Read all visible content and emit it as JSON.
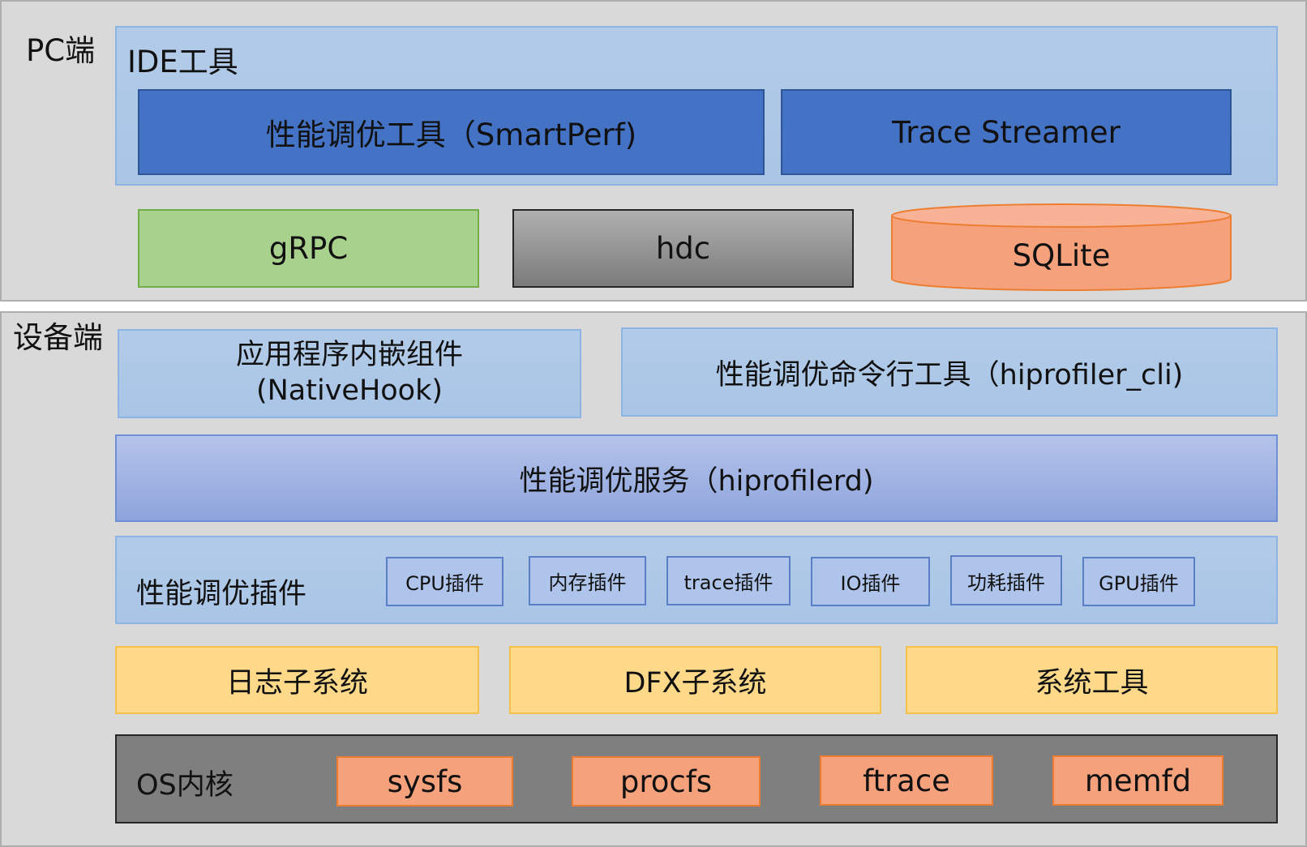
{
  "pc_section": {
    "label": "PC端",
    "ide": {
      "title": "IDE工具",
      "smartperf": "性能调优工具（SmartPerf)",
      "trace_streamer": "Trace Streamer"
    },
    "grpc": "gRPC",
    "hdc": "hdc",
    "sqlite": "SQLite"
  },
  "device_section": {
    "label": "设备端",
    "nativehook_line1": "应用程序内嵌组件",
    "nativehook_line2": "(NativeHook)",
    "cli": "性能调优命令行工具（hiprofiler_cli)",
    "service": "性能调优服务（hiprofilerd)",
    "plugins": {
      "title": "性能调优插件",
      "items": [
        "CPU插件",
        "内存插件",
        "trace插件",
        "IO插件",
        "功耗插件",
        "GPU插件"
      ]
    },
    "subsystems": [
      "日志子系统",
      "DFX子系统",
      "系统工具"
    ],
    "os": {
      "title": "OS内核",
      "items": [
        "sysfs",
        "procfs",
        "ftrace",
        "memfd"
      ]
    }
  },
  "colors": {
    "panel": "#d9d9d9",
    "light_blue": "#a9c5e6",
    "dark_blue": "#4472c4",
    "purple": "#8ea4dc",
    "yellow": "#ffd98a",
    "green": "#a9d18e",
    "gray": "#7f7f7f",
    "salmon": "#f5a17c"
  }
}
